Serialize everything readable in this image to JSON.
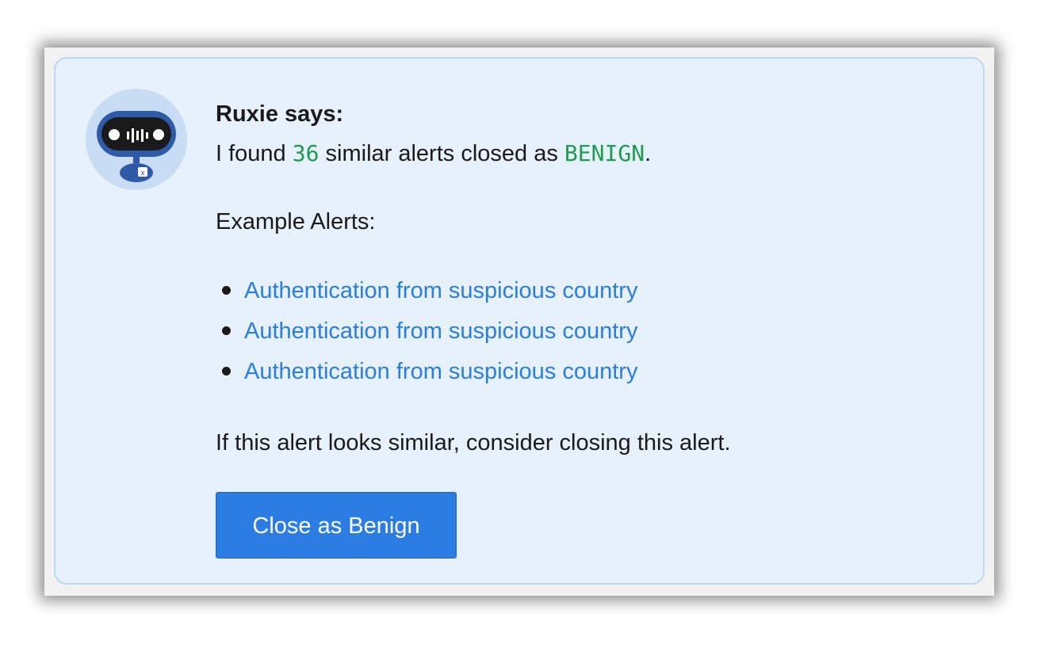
{
  "assistant": {
    "avatar_icon": "robot-icon",
    "heading": "Ruxie says:",
    "found_prefix": "I found ",
    "count": "36",
    "found_middle": " similar alerts closed as ",
    "verdict": "BENIGN",
    "found_suffix": "."
  },
  "examples": {
    "label": "Example Alerts:",
    "items": [
      {
        "title": "Authentication from suspicious country"
      },
      {
        "title": "Authentication from suspicious country"
      },
      {
        "title": "Authentication from suspicious country"
      }
    ]
  },
  "hint": "If this alert looks similar, consider closing this alert.",
  "action": {
    "button_label": "Close as Benign"
  },
  "colors": {
    "card_background": "#e7f1fb",
    "link": "#2a7de1",
    "highlight": "#1e9b4f",
    "button": "#2b7de3"
  }
}
